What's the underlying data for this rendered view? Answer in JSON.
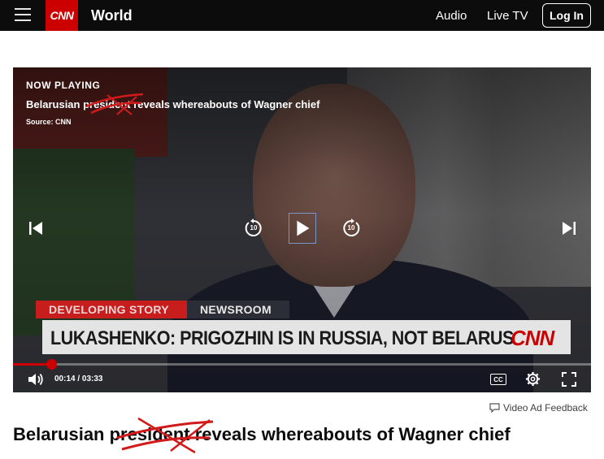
{
  "header": {
    "logo_text": "CNN",
    "section": "World",
    "nav": [
      "Audio",
      "Live TV"
    ],
    "login_label": "Log In"
  },
  "video": {
    "now_playing_label": "NOW PLAYING",
    "title": "Belarusian president reveals whereabouts of Wagner chief",
    "source": "Source: CNN",
    "lower_third": {
      "tag_developing": "DEVELOPING STORY",
      "tag_newsroom": "NEWSROOM",
      "headline": "LUKASHENKO: PRIGOZHIN IS IN RUSSIA, NOT BELARUS",
      "logo": "CNN"
    },
    "skip_back_label": "10",
    "skip_forward_label": "10",
    "time_display": "00:14 / 03:33",
    "progress": 0.066,
    "cc_label": "CC"
  },
  "feedback_label": "Video Ad Feedback",
  "article": {
    "title": "Belarusian president reveals whereabouts of Wagner chief"
  },
  "colors": {
    "brand_red": "#cc0000",
    "header_bg": "#0c0c0c",
    "annotation_red": "#d11a1a"
  },
  "icons": {
    "menu": "hamburger-icon",
    "previous": "skip-previous-icon",
    "back": "replay-10-icon",
    "play": "play-icon",
    "forward": "forward-10-icon",
    "next": "skip-next-icon",
    "volume": "volume-icon",
    "captions": "closed-captions-icon",
    "settings": "gear-icon",
    "fullscreen": "fullscreen-icon",
    "feedback": "comment-icon"
  }
}
